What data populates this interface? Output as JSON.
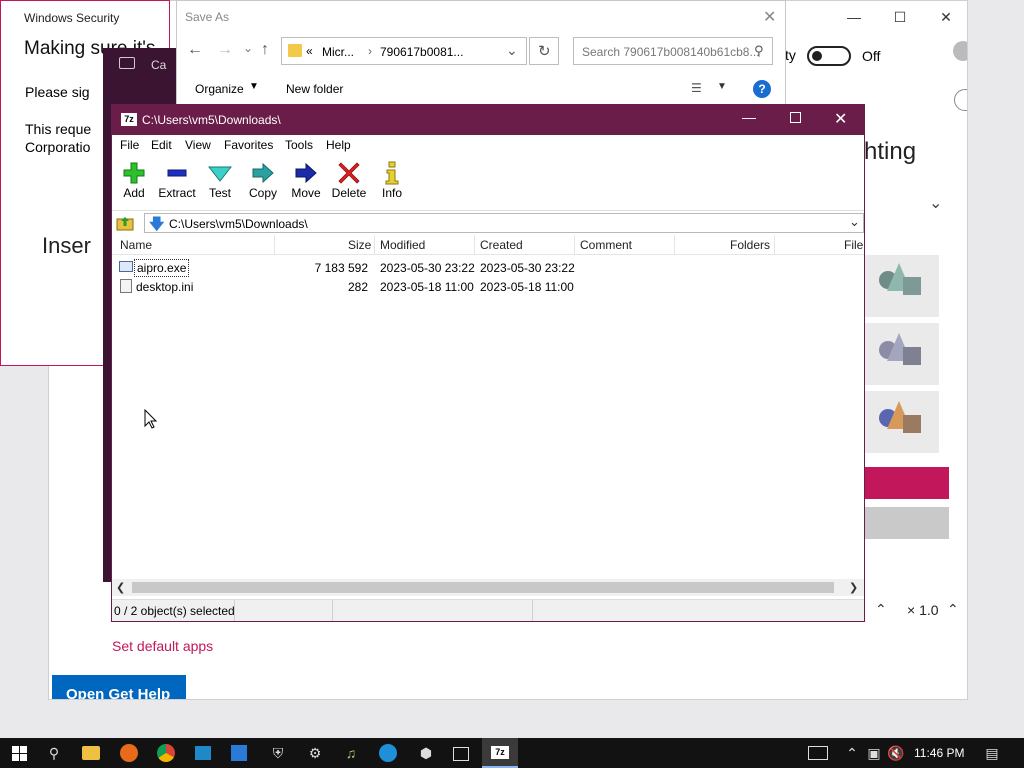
{
  "settings_bg": {
    "toggle_label": "ty",
    "toggle_state": "Off",
    "heading_frag": "hting",
    "set_default_apps": "Set default apps",
    "open_get_help": "Open Get Help",
    "zoom_left": "⌃",
    "zoom_value": "× 1.0",
    "accent": "#c2185b"
  },
  "winsec": {
    "title": "Windows Security",
    "heading": "Making sure it's",
    "line1": "Please sig",
    "line2": "This reque",
    "line3": "Corporatio",
    "line4": "Inser"
  },
  "camera": {
    "title": "Ca"
  },
  "saveas": {
    "title": "Save As",
    "crumb_prefix": "«",
    "crumb1": "Micr...",
    "crumb2": "790617b0081...",
    "search_placeholder": "Search 790617b008140b61cb8...",
    "organize": "Organize",
    "new_folder": "New folder"
  },
  "zip": {
    "title": "C:\\Users\\vm5\\Downloads\\",
    "menu": [
      "File",
      "Edit",
      "View",
      "Favorites",
      "Tools",
      "Help"
    ],
    "tools": [
      "Add",
      "Extract",
      "Test",
      "Copy",
      "Move",
      "Delete",
      "Info"
    ],
    "path": "C:\\Users\\vm5\\Downloads\\",
    "columns": [
      "Name",
      "Size",
      "Modified",
      "Created",
      "Comment",
      "Folders",
      "File"
    ],
    "rows": [
      {
        "name": "aipro.exe",
        "size": "7 183 592",
        "modified": "2023-05-30 23:22",
        "created": "2023-05-30 23:22"
      },
      {
        "name": "desktop.ini",
        "size": "282",
        "modified": "2023-05-18 11:00",
        "created": "2023-05-18 11:00"
      }
    ],
    "status": "0 / 2 object(s) selected",
    "colors": {
      "titlebar": "#6b1d49"
    }
  },
  "taskbar": {
    "clock": "11:46 PM"
  }
}
